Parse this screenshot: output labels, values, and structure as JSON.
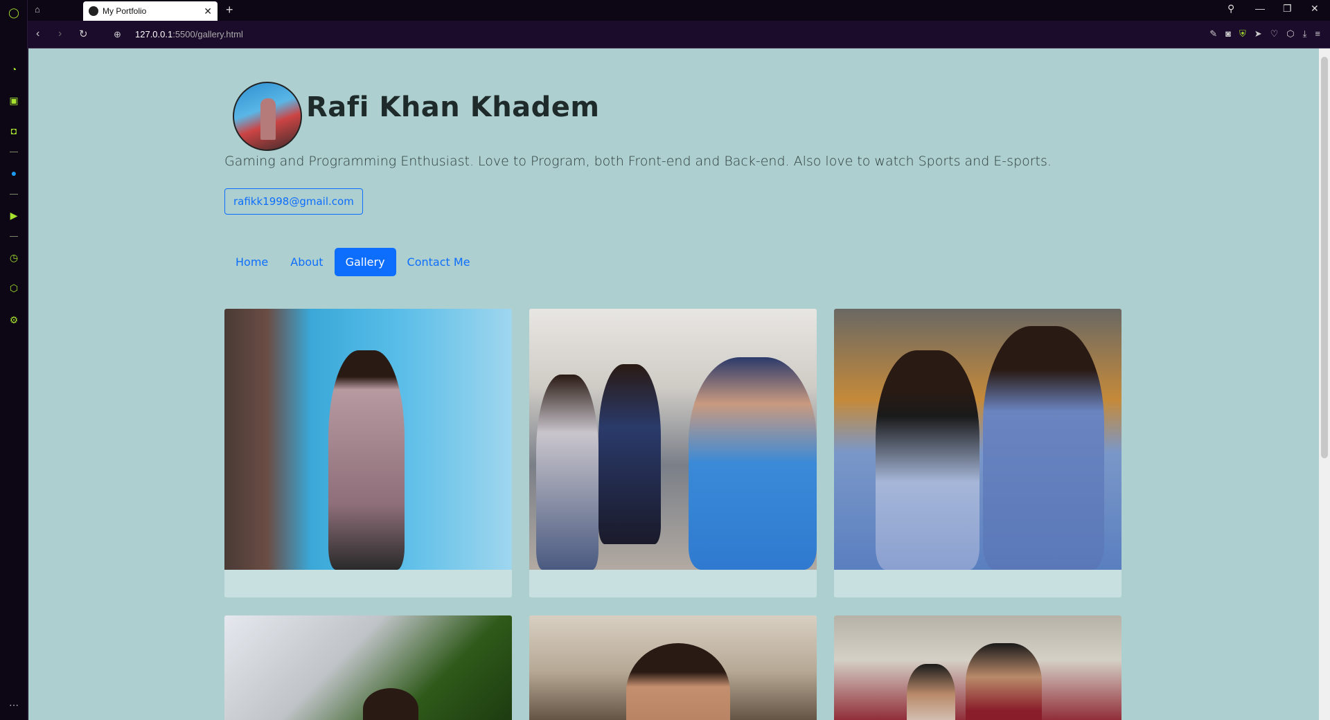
{
  "browser": {
    "tab_title": "My Portfolio",
    "url_host": "127.0.0.1",
    "url_rest": ":5500/gallery.html"
  },
  "profile": {
    "name": "Rafi Khan Khadem",
    "bio": "Gaming and Programming Enthusiast. Love to Program, both Front-end and Back-end. Also love to watch Sports and E-sports.",
    "email": "rafikk1998@gmail.com"
  },
  "nav": {
    "items": [
      "Home",
      "About",
      "Gallery",
      "Contact Me"
    ],
    "active": "Gallery"
  },
  "gallery": {
    "cards": [
      "photo-1",
      "photo-2",
      "photo-3",
      "photo-4",
      "photo-5",
      "photo-6"
    ]
  },
  "colors": {
    "page_bg": "#aecfcf",
    "accent": "#0d6efd",
    "browser_chrome": "#0d0615"
  }
}
